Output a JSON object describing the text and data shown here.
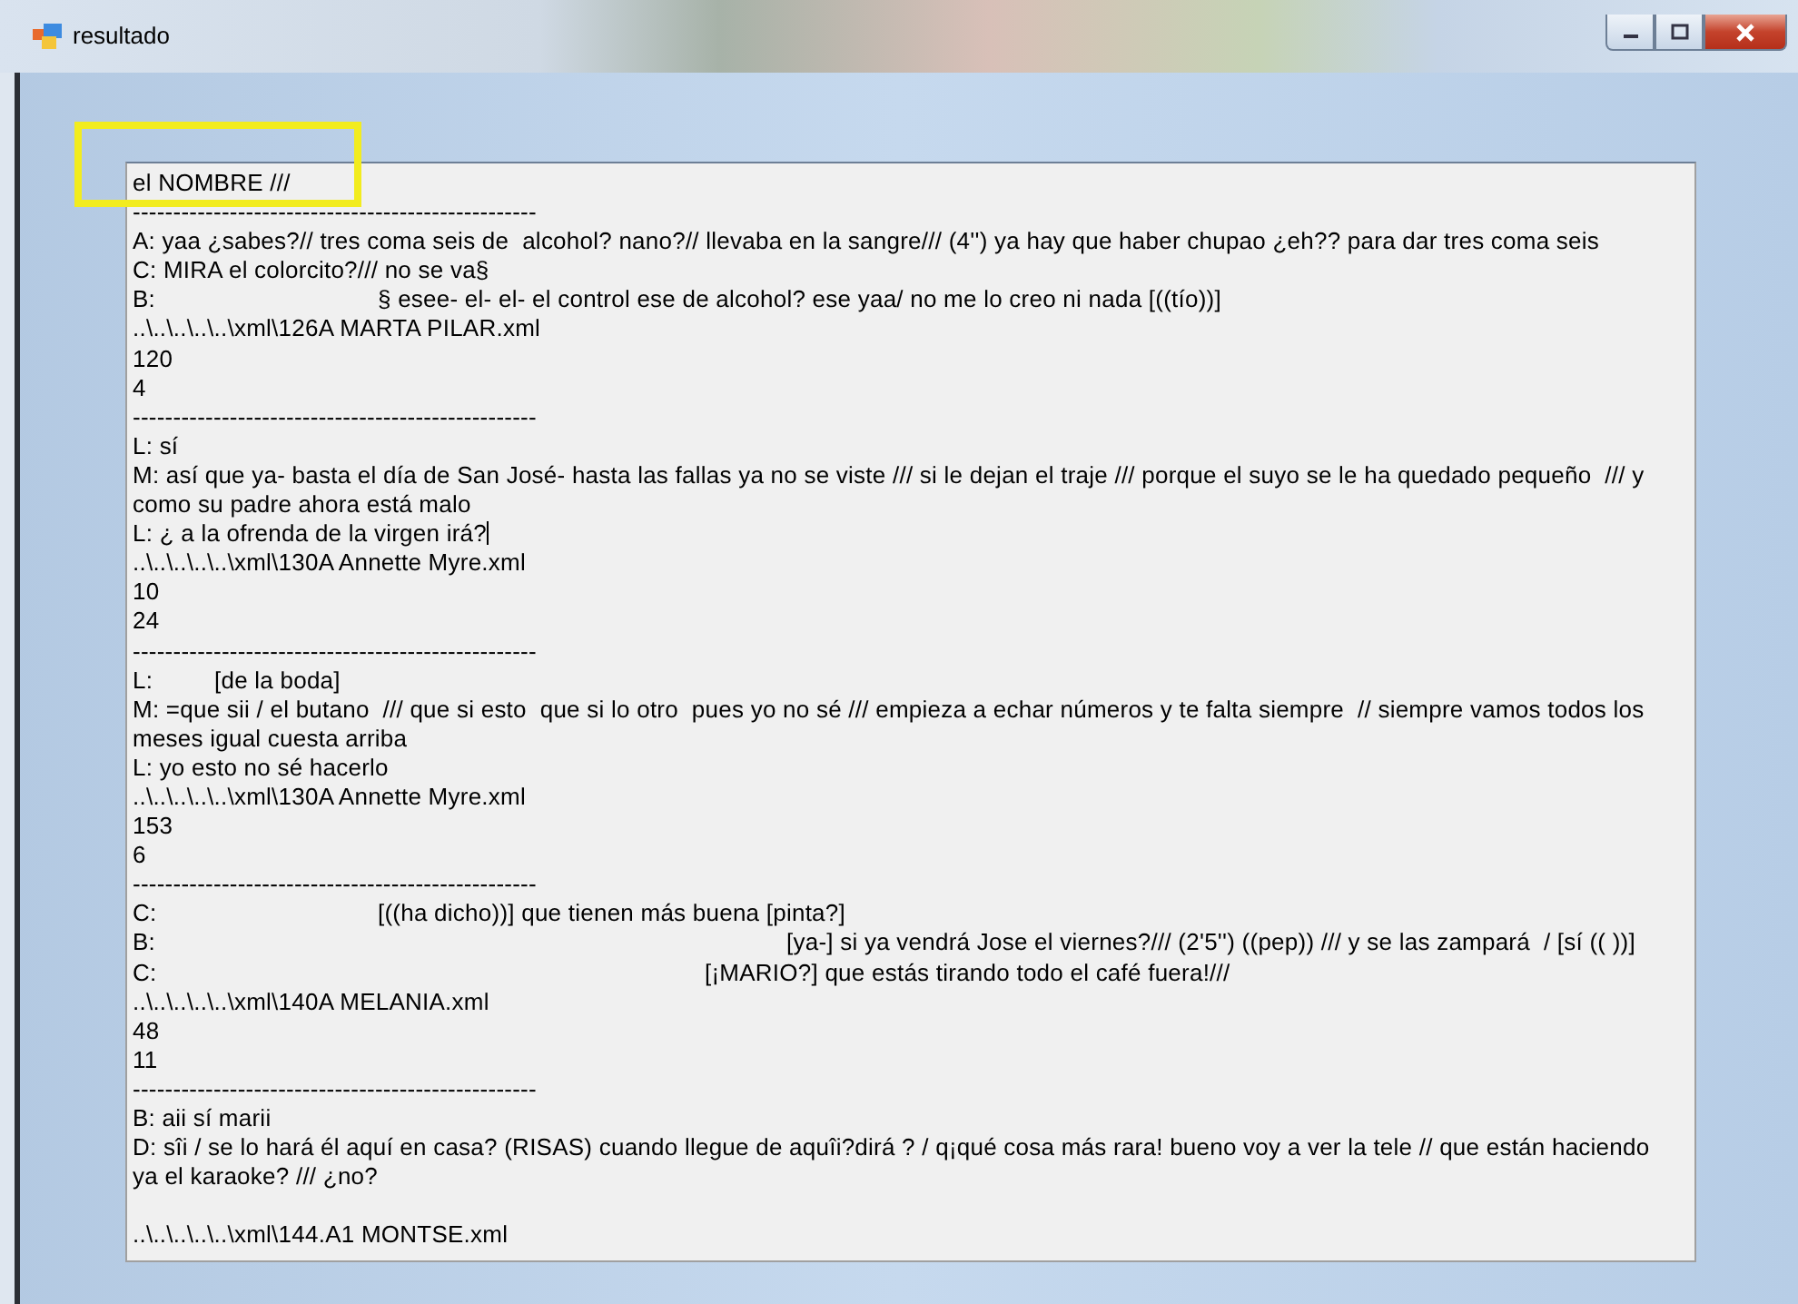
{
  "window": {
    "title": "resultado"
  },
  "text_box": {
    "lines": [
      {
        "kind": "text",
        "text": "el NOMBRE ///",
        "caret": false
      },
      {
        "kind": "text",
        "text": "--------------------------------------------------",
        "caret": false
      },
      {
        "kind": "text",
        "text": "A: yaa ¿sabes?// tres coma seis de  alcohol? nano?// llevaba en la sangre/// (4'') ya hay que haber chupao ¿eh?? para dar tres coma seis",
        "caret": false
      },
      {
        "kind": "text",
        "text": "C: MIRA el colorcito?/// no se va§",
        "caret": false
      },
      {
        "kind": "text",
        "text": "B:\t\t\t§ esee- el- el- el control ese de alcohol? ese yaa/ no me lo creo ni nada [((tío))]",
        "caret": false
      },
      {
        "kind": "text",
        "text": "..\\..\\..\\..\\..\\xml\\126A MARTA PILAR.xml",
        "caret": false
      },
      {
        "kind": "text",
        "text": "120",
        "caret": false
      },
      {
        "kind": "text",
        "text": "4",
        "caret": false
      },
      {
        "kind": "text",
        "text": "--------------------------------------------------",
        "caret": false
      },
      {
        "kind": "text",
        "text": "L: sí",
        "caret": false
      },
      {
        "kind": "text",
        "text": "M: así que ya- basta el día de San José- hasta las fallas ya no se viste /// si le dejan el traje /// porque el suyo se le ha quedado pequeño  /// y",
        "caret": false
      },
      {
        "kind": "text",
        "text": "como su padre ahora está malo",
        "caret": false
      },
      {
        "kind": "text",
        "text": "L: ¿ a la ofrenda de la virgen irá?",
        "caret": true
      },
      {
        "kind": "text",
        "text": "..\\..\\..\\..\\..\\xml\\130A Annette Myre.xml",
        "caret": false
      },
      {
        "kind": "text",
        "text": "10",
        "caret": false
      },
      {
        "kind": "text",
        "text": "24",
        "caret": false
      },
      {
        "kind": "text",
        "text": "--------------------------------------------------",
        "caret": false
      },
      {
        "kind": "text",
        "text": "L:\t[de la boda]",
        "caret": false
      },
      {
        "kind": "text",
        "text": "M: =que sii / el butano  /// que si esto  que si lo otro  pues yo no sé /// empieza a echar números y te falta siempre  // siempre vamos todos los",
        "caret": false
      },
      {
        "kind": "text",
        "text": "meses igual cuesta arriba",
        "caret": false
      },
      {
        "kind": "text",
        "text": "L: yo esto no sé hacerlo",
        "caret": false
      },
      {
        "kind": "text",
        "text": "..\\..\\..\\..\\..\\xml\\130A Annette Myre.xml",
        "caret": false
      },
      {
        "kind": "text",
        "text": "153",
        "caret": false
      },
      {
        "kind": "text",
        "text": "6",
        "caret": false
      },
      {
        "kind": "text",
        "text": "--------------------------------------------------",
        "caret": false
      },
      {
        "kind": "text",
        "text": "C:\t\t\t[((ha dicho))] que tienen más buena [pinta?]",
        "caret": false
      },
      {
        "kind": "text",
        "text": "B:\t\t\t\t\t\t\t\t[ya-] si ya vendrá Jose el viernes?/// (2'5'') ((pep)) /// y se las zampará  / [sí (( ))]",
        "caret": false
      },
      {
        "kind": "text",
        "text": "C:\t\t\t\t\t\t\t[¡MARIO?] que estás tirando todo el café fuera!///",
        "caret": false
      },
      {
        "kind": "text",
        "text": "..\\..\\..\\..\\..\\xml\\140A MELANIA.xml",
        "caret": false
      },
      {
        "kind": "text",
        "text": "48",
        "caret": false
      },
      {
        "kind": "text",
        "text": "11",
        "caret": false
      },
      {
        "kind": "text",
        "text": "--------------------------------------------------",
        "caret": false
      },
      {
        "kind": "text",
        "text": "B: aii sí marii",
        "caret": false
      },
      {
        "kind": "text",
        "text": "D: sîi / se lo hará él aquí en casa? (RISAS) cuando llegue de aquîi?dirá ? / q¡qué cosa más rara! bueno voy a ver la tele // que están haciendo",
        "caret": false
      },
      {
        "kind": "text",
        "text": "ya el karaoke? /// ¿no?",
        "caret": false
      },
      {
        "kind": "blank"
      },
      {
        "kind": "text",
        "text": "..\\..\\..\\..\\..\\xml\\144.A1 MONTSE.xml",
        "caret": false
      }
    ]
  }
}
